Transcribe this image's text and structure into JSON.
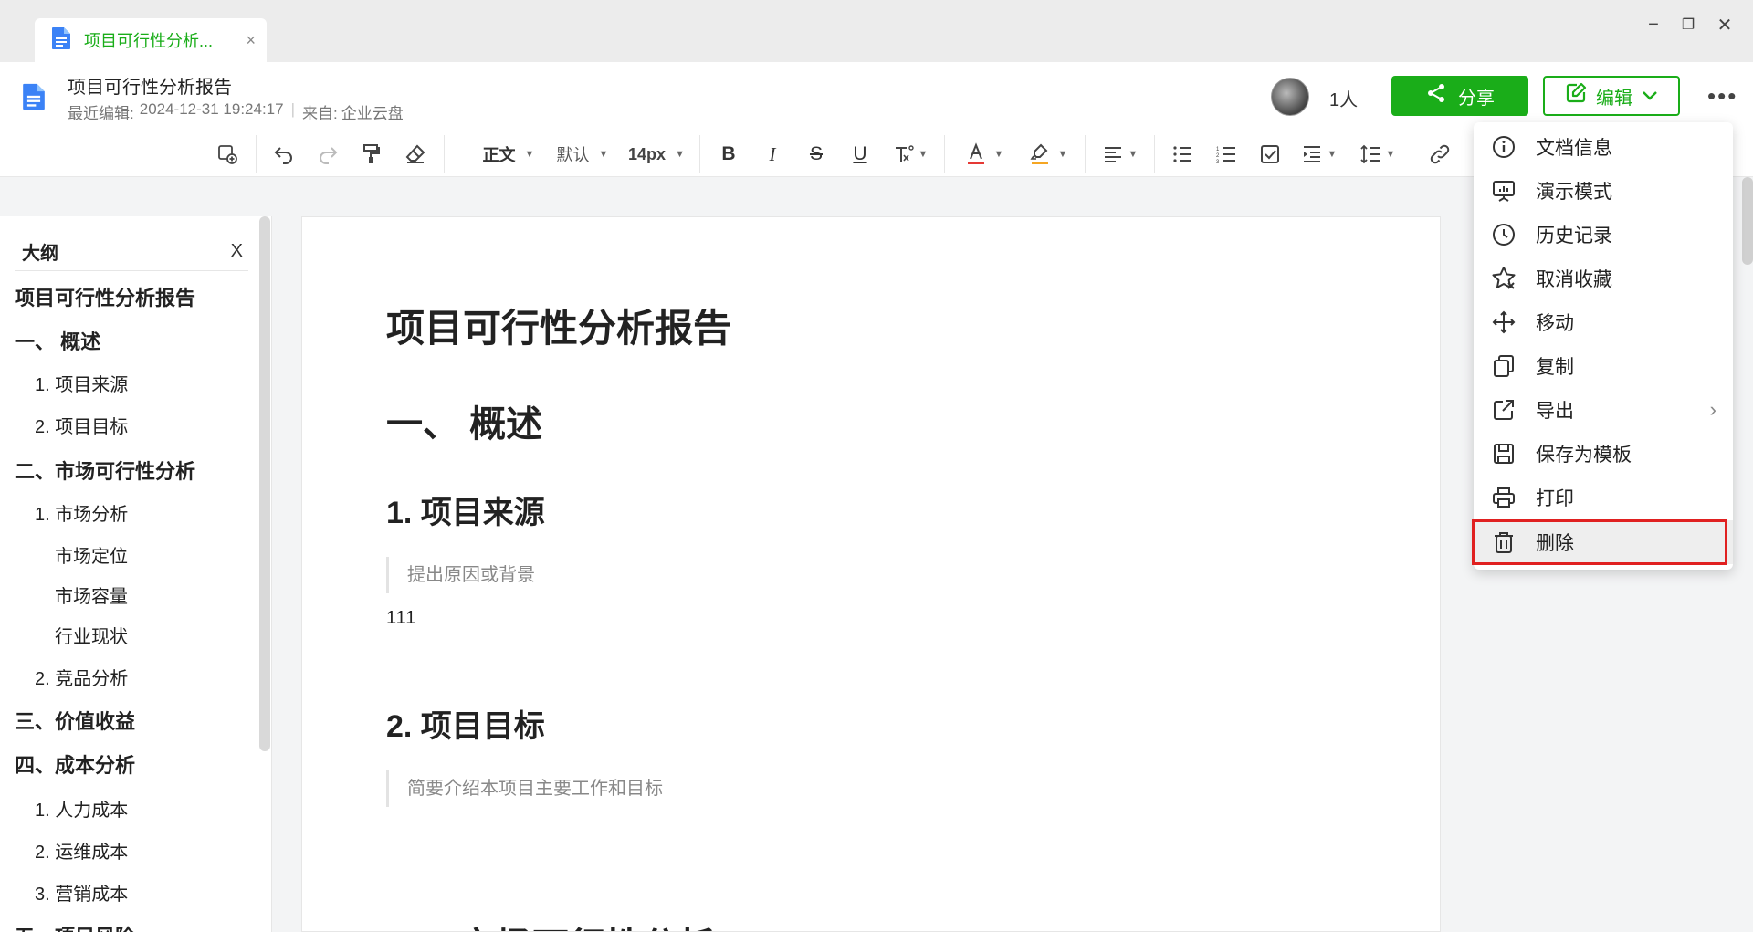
{
  "window": {
    "tab_title": "项目可行性分析...",
    "tab_close": "×",
    "controls": [
      "−",
      "❐",
      "✕"
    ]
  },
  "header": {
    "doc_title": "项目可行性分析报告",
    "last_edit_label": "最近编辑:",
    "last_edit_time": "2024-12-31 19:24:17",
    "source_label": "来自:",
    "source": "企业云盘",
    "collaborators": "1人",
    "share_label": "分享",
    "edit_label": "编辑",
    "more": "•••"
  },
  "toolbar": {
    "paragraph_style": "正文",
    "font_family": "默认",
    "font_size": "14px",
    "colors": {
      "text_underline": "#e53935",
      "highlight_underline": "#f5a623"
    }
  },
  "outline": {
    "title": "大纲",
    "close": "X",
    "items": [
      {
        "label": "项目可行性分析报告",
        "level": 1
      },
      {
        "label": "一、  概述",
        "level": 1
      },
      {
        "label": "1. 项目来源",
        "level": 2
      },
      {
        "label": "2. 项目目标",
        "level": 2
      },
      {
        "label": "二、市场可行性分析",
        "level": 1
      },
      {
        "label": "1. 市场分析",
        "level": 2
      },
      {
        "label": "市场定位",
        "level": 3
      },
      {
        "label": "市场容量",
        "level": 3
      },
      {
        "label": "行业现状",
        "level": 3
      },
      {
        "label": "2. 竞品分析",
        "level": 2
      },
      {
        "label": "三、价值收益",
        "level": 1
      },
      {
        "label": "四、成本分析",
        "level": 1
      },
      {
        "label": "1. 人力成本",
        "level": 2
      },
      {
        "label": "2. 运维成本",
        "level": 2
      },
      {
        "label": "3. 营销成本",
        "level": 2
      },
      {
        "label": "五、项目风险",
        "level": 1
      }
    ]
  },
  "document": {
    "title": "项目可行性分析报告",
    "h1_overview": "一、  概述",
    "h2_source": "1. 项目来源",
    "quote_source": "提出原因或背景",
    "body_111": "111",
    "h2_goal": "2. 项目目标",
    "quote_goal": "简要介绍本项目主要工作和目标",
    "h1_market": "二、市场可行性分析"
  },
  "menu": {
    "items": [
      {
        "label": "文档信息",
        "icon": "info-icon"
      },
      {
        "label": "演示模式",
        "icon": "presentation-icon"
      },
      {
        "label": "历史记录",
        "icon": "clock-icon"
      },
      {
        "label": "取消收藏",
        "icon": "star-icon"
      },
      {
        "label": "移动",
        "icon": "move-icon"
      },
      {
        "label": "复制",
        "icon": "copy-icon"
      },
      {
        "label": "导出",
        "icon": "export-icon",
        "has_submenu": true
      },
      {
        "label": "保存为模板",
        "icon": "save-icon"
      },
      {
        "label": "打印",
        "icon": "printer-icon"
      },
      {
        "label": "删除",
        "icon": "trash-icon",
        "active": true
      }
    ],
    "submenu_arrow": "›"
  },
  "accent": {
    "green": "#1aad19",
    "highlight_border": "#e02020",
    "doc_icon_blue": "#3b82f6"
  }
}
